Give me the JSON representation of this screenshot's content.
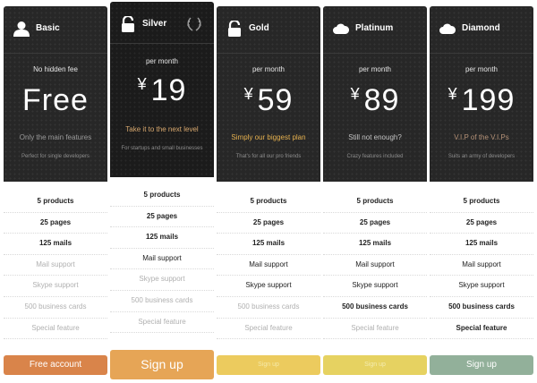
{
  "plans": [
    {
      "name": "Basic",
      "icon": "user-icon",
      "period": "No hidden fee",
      "currency": "",
      "price": "Free",
      "tagline": "Only the main features",
      "tagline_color": "#9a9a9a",
      "subtext": "Perfect for single developers",
      "features": [
        "5 products",
        "25 pages",
        "125 mails",
        "Mail support",
        "Skype support",
        "500 business cards",
        "Special feature"
      ],
      "cta": "Free account"
    },
    {
      "name": "Silver",
      "icon": "unlock-icon",
      "badge_icon": "laurel-icon",
      "period": "per month",
      "currency": "¥",
      "price": "19",
      "tagline": "Take it to the next level",
      "tagline_color": "#d8a86e",
      "subtext": "For startups and small businesses",
      "features": [
        "5 products",
        "25 pages",
        "125 mails",
        "Mail support",
        "Skype support",
        "500 business cards",
        "Special feature"
      ],
      "cta": "Sign up"
    },
    {
      "name": "Gold",
      "icon": "unlock-icon",
      "period": "per month",
      "currency": "¥",
      "price": "59",
      "tagline": "Simply our biggest plan",
      "tagline_color": "#e6b14f",
      "subtext": "That's for all our pro friends",
      "features": [
        "5 products",
        "25 pages",
        "125 mails",
        "Mail support",
        "Skype support",
        "500 business cards",
        "Special feature"
      ],
      "cta": "Sign up"
    },
    {
      "name": "Platinum",
      "icon": "cloud-icon",
      "period": "per month",
      "currency": "¥",
      "price": "89",
      "tagline": "Still not enough?",
      "tagline_color": "#c4c4c4",
      "subtext": "Crazy features included",
      "features": [
        "5 products",
        "25 pages",
        "125 mails",
        "Mail support",
        "Skype support",
        "500 business cards",
        "Special feature"
      ],
      "cta": "Sign up"
    },
    {
      "name": "Diamond",
      "icon": "cloud-icon",
      "period": "per month",
      "currency": "¥",
      "price": "199",
      "tagline": "V.I.P of the V.I.Ps",
      "tagline_color": "#b59278",
      "subtext": "Suits an army of developers",
      "features": [
        "5 products",
        "25 pages",
        "125 mails",
        "Mail support",
        "Skype support",
        "500 business cards",
        "Special feature"
      ],
      "cta": "Sign up"
    }
  ]
}
